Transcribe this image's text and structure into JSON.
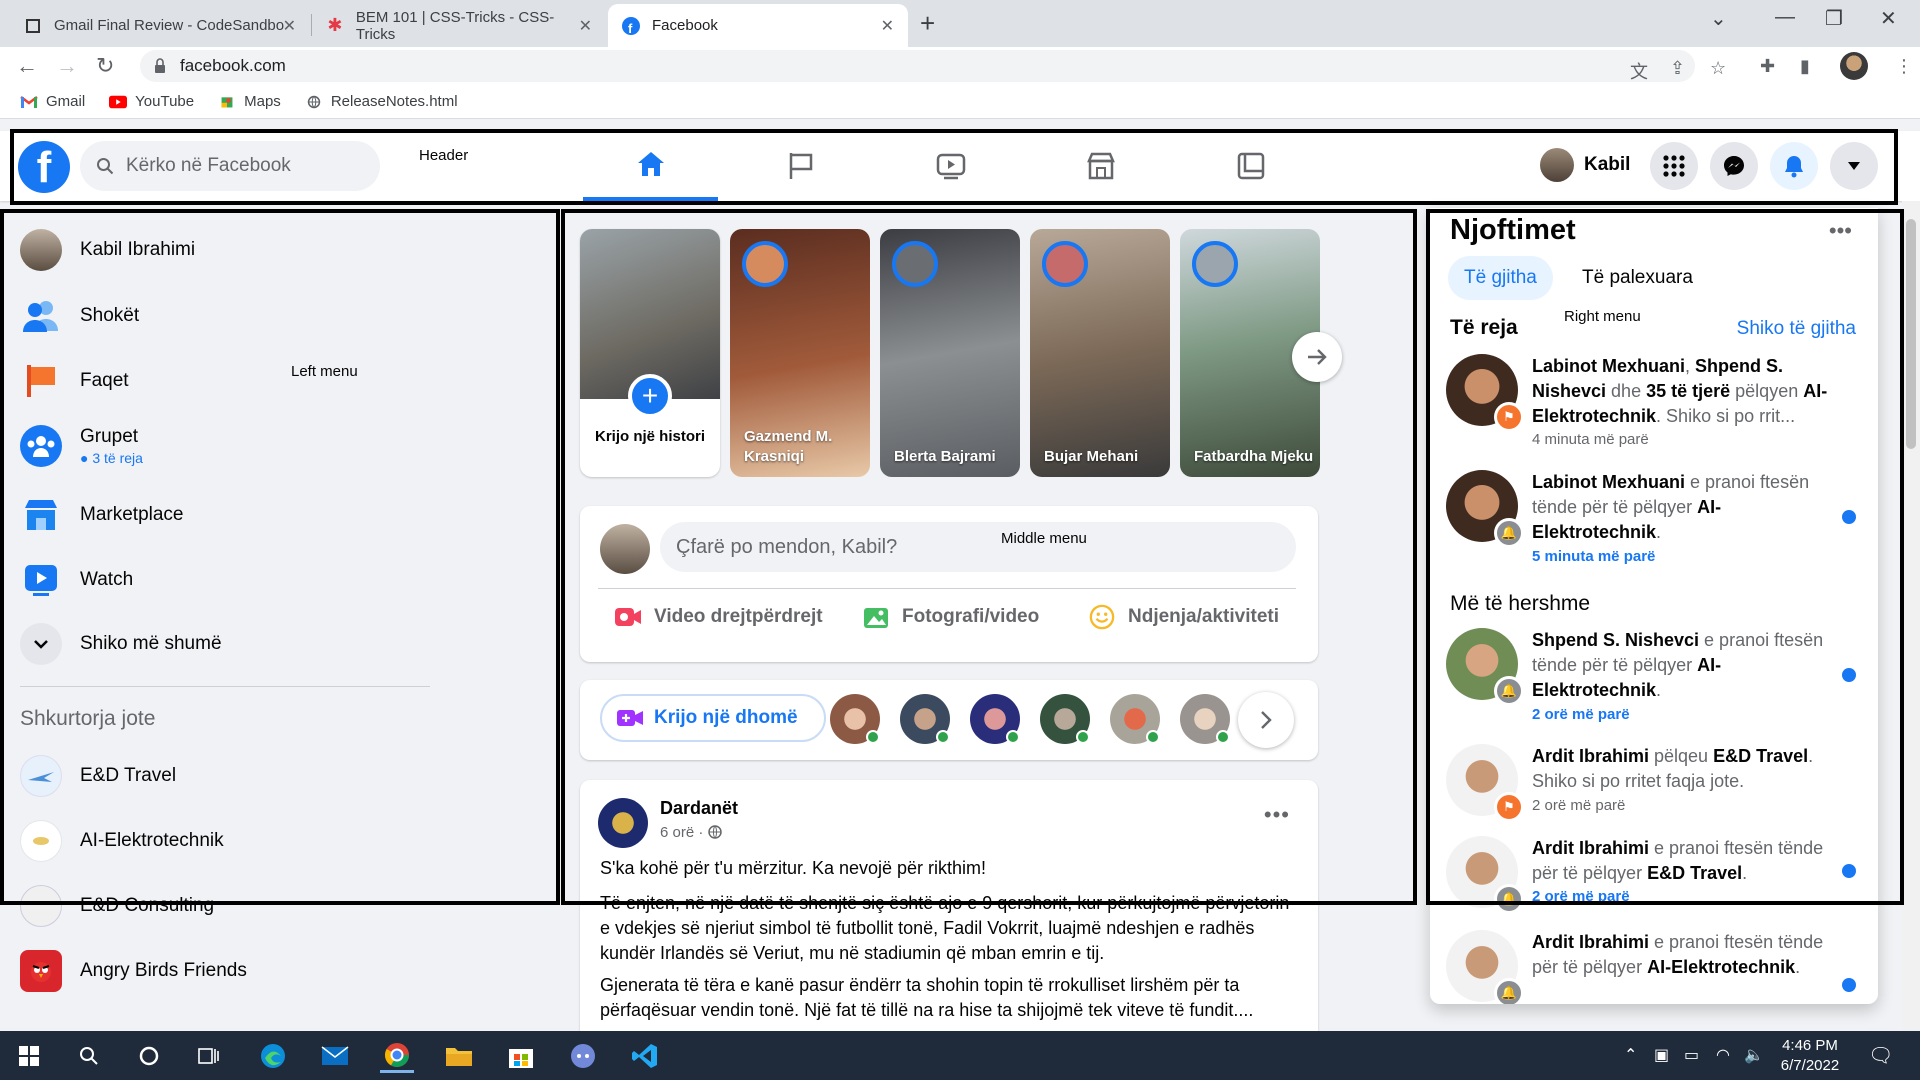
{
  "browser": {
    "tabs": [
      {
        "title": "Gmail Final Review - CodeSandbo",
        "active": false
      },
      {
        "title": "BEM 101 | CSS-Tricks - CSS-Tricks",
        "active": false
      },
      {
        "title": "Facebook",
        "active": true
      }
    ],
    "url": "facebook.com",
    "bookmarks": [
      "Gmail",
      "YouTube",
      "Maps",
      "ReleaseNotes.html"
    ]
  },
  "header": {
    "search_placeholder": "Kërko në Facebook",
    "annotation": "Header",
    "profile_name": "Kabil"
  },
  "left_menu": {
    "annotation": "Left menu",
    "items": [
      {
        "label": "Kabil Ibrahimi",
        "icon": "profile-avatar"
      },
      {
        "label": "Shokët",
        "icon": "friends-icon"
      },
      {
        "label": "Faqet",
        "icon": "pages-flag-icon"
      },
      {
        "label": "Grupet",
        "icon": "groups-icon",
        "sub": "3 të reja"
      },
      {
        "label": "Marketplace",
        "icon": "marketplace-icon"
      },
      {
        "label": "Watch",
        "icon": "watch-icon"
      },
      {
        "label": "Shiko më shumë",
        "icon": "chevron-down-icon"
      }
    ],
    "shortcuts_heading": "Shkurtorja jote",
    "shortcuts": [
      {
        "label": "E&D Travel"
      },
      {
        "label": "AI-Elektrotechnik"
      },
      {
        "label": "E&D Consulting"
      },
      {
        "label": "Angry Birds Friends"
      }
    ]
  },
  "middle": {
    "annotation": "Middle menu",
    "create_story": "Krijo një histori",
    "stories": [
      {
        "name": "Gazmend M. Krasniqi"
      },
      {
        "name": "Blerta Bajrami"
      },
      {
        "name": "Bujar Mehani"
      },
      {
        "name": "Fatbardha Mjeku"
      }
    ],
    "composer_placeholder": "Çfarë po mendon, Kabil?",
    "composer_actions": [
      "Video drejtpërdrejt",
      "Fotografi/video",
      "Ndjenja/aktiviteti"
    ],
    "room_button": "Krijo një dhomë",
    "post": {
      "author": "Dardanët",
      "time": "6 orë ·",
      "line1": "S'ka kohë për t'u mërzitur. Ka nevojë për rikthim!",
      "para1": "Të enjten, në një datë të shenjtë siç është ajo e 9 qershorit, kur përkujtojmë përvjetorin e vdekjes së njeriut simbol të futbollit tonë, Fadil Vokrrit, luajmë ndeshjen e radhës kundër Irlandës së Veriut, mu në stadiumin që mban emrin e tij.",
      "para2": "Gjenerata të tëra e kanë pasur ëndërr ta shohin topin të rrokulliset lirshëm për ta përfaqësuar vendin tonë. Një fat të tillë na ra hise ta shijojmë tek viteve të fundit...."
    }
  },
  "notifications": {
    "annotation": "Right menu",
    "title": "Njoftimet",
    "tabs": [
      "Të gjitha",
      "Të palexuara"
    ],
    "section_new": "Të reja",
    "see_all": "Shiko të gjitha",
    "section_older": "Më të hershme",
    "items": [
      {
        "t1": "Labinot Mexhuani",
        "t2": ", ",
        "t3": "Shpend S. Nishevci",
        "t4": " dhe ",
        "t5": "35 të tjerë",
        "t6": " pëlqyen ",
        "t7": "AI-Elektrotechnik",
        "t8": ". Shiko si po rrit...",
        "time": "4 minuta më parë",
        "unread": false
      },
      {
        "t1": "Labinot Mexhuani",
        "t2": " e pranoi ftesën tënde për të pëlqyer ",
        "t3": "AI-Elektrotechnik",
        "t4": ".",
        "time": "5 minuta më parë",
        "unread": true
      },
      {
        "t1": "Shpend S. Nishevci",
        "t2": " e pranoi ftesën tënde për të pëlqyer ",
        "t3": "AI-Elektrotechnik",
        "t4": ".",
        "time": "2 orë më parë",
        "unread": true
      },
      {
        "t1": "Ardit Ibrahimi",
        "t2": " pëlqeu ",
        "t3": "E&D Travel",
        "t4": ". Shiko si po rritet faqja jote.",
        "time": "2 orë më parë",
        "unread": false
      },
      {
        "t1": "Ardit Ibrahimi",
        "t2": " e pranoi ftesën tënde për të pëlqyer ",
        "t3": "E&D Travel",
        "t4": ".",
        "time": "2 orë më parë",
        "unread": true
      },
      {
        "t1": "Ardit Ibrahimi",
        "t2": " e pranoi ftesën tënde për të pëlqyer ",
        "t3": "AI-Elektrotechnik",
        "t4": ".",
        "time": "",
        "unread": true
      }
    ]
  },
  "taskbar": {
    "time": "4:46 PM",
    "date": "6/7/2022"
  },
  "colors": {
    "fb_blue": "#1877f2",
    "background": "#f0f2f5"
  }
}
